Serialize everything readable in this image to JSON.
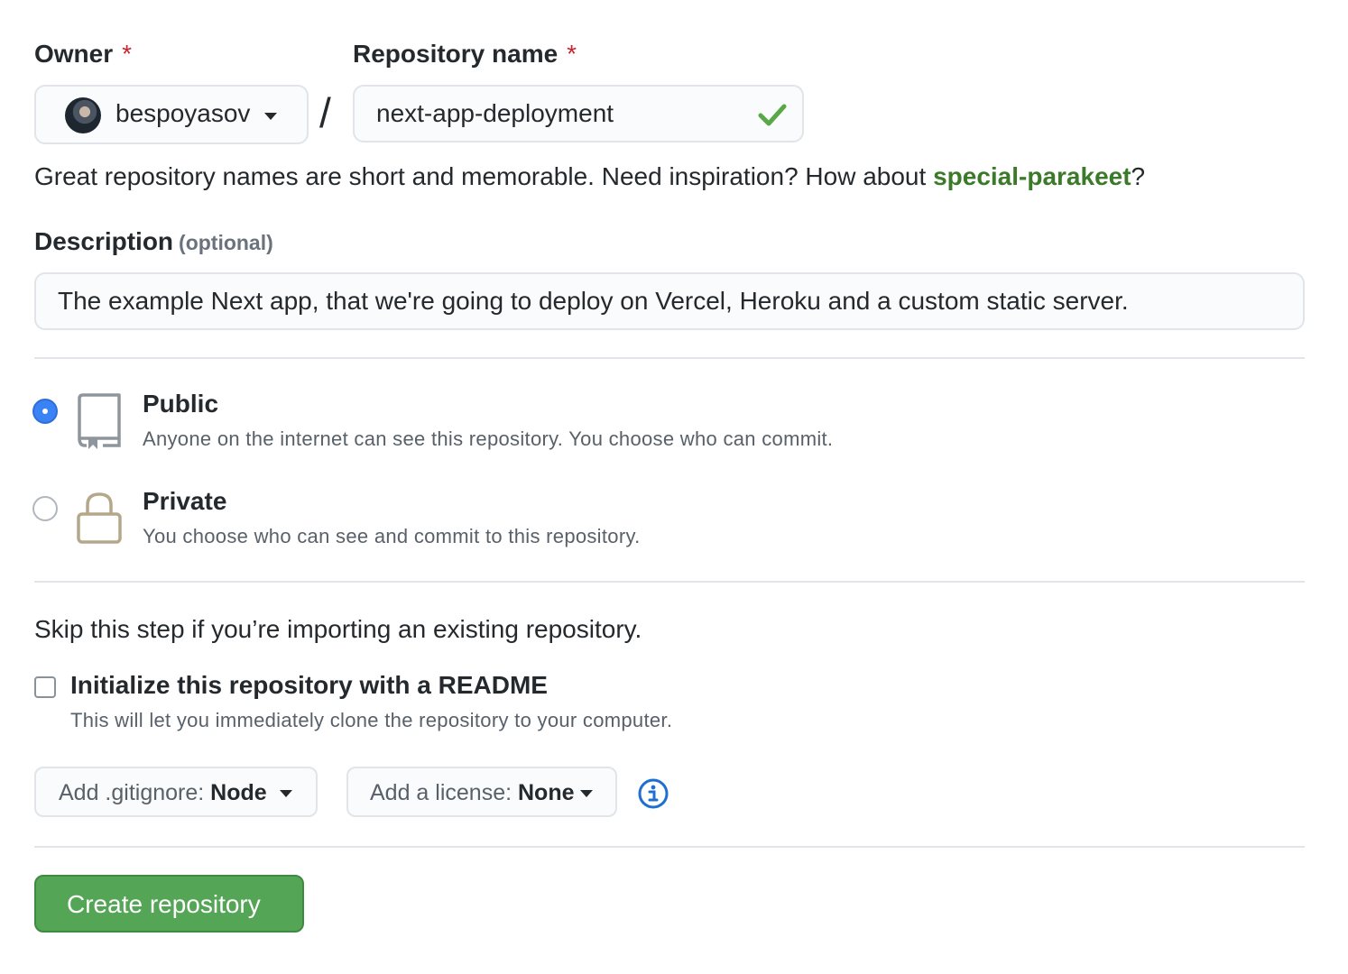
{
  "owner": {
    "label": "Owner",
    "required_mark": "*",
    "selected": "bespoyasov"
  },
  "separator": "/",
  "repo_name": {
    "label": "Repository name",
    "required_mark": "*",
    "value": "next-app-deployment",
    "valid": true
  },
  "hint": {
    "prefix": "Great repository names are short and memorable. Need inspiration? How about ",
    "suggestion": "special-parakeet",
    "suffix": "?"
  },
  "description": {
    "label": "Description",
    "optional": "(optional)",
    "value": "The example Next app, that we're going to deploy on Vercel, Heroku and a custom static server."
  },
  "visibility": {
    "options": [
      {
        "title": "Public",
        "subtitle": "Anyone on the internet can see this repository. You choose who can commit.",
        "icon": "repo-icon",
        "checked": true
      },
      {
        "title": "Private",
        "subtitle": "You choose who can see and commit to this repository.",
        "icon": "lock-icon",
        "checked": false
      }
    ]
  },
  "init": {
    "skip_text": "Skip this step if you’re importing an existing repository.",
    "readme_label": "Initialize this repository with a README",
    "readme_sub": "This will let you immediately clone the repository to your computer.",
    "readme_checked": false
  },
  "gitignore": {
    "label": "Add .gitignore:",
    "value": "Node"
  },
  "license": {
    "label": "Add a license:",
    "value": "None"
  },
  "info_icon": "info-icon",
  "submit": {
    "label": "Create repository"
  },
  "colors": {
    "accent_green": "#55a557",
    "radio_blue": "#3b82f6",
    "link_green": "#3a7a29",
    "required_red": "#cb2431",
    "lock_tan": "#b5a88a"
  }
}
